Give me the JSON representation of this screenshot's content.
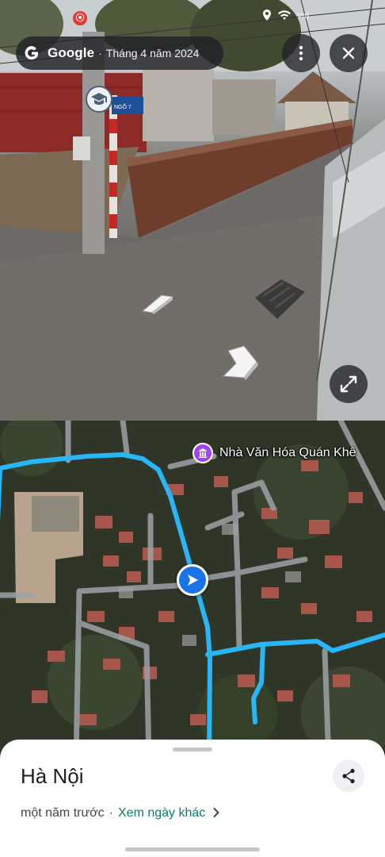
{
  "status_bar": {
    "icons": [
      "gallery-icon",
      "recording-icon",
      "location-icon",
      "wifi-icon",
      "signal-icon"
    ],
    "network_label": "Vo)"
  },
  "street_view": {
    "chip": {
      "brand": "Google",
      "separator": "·",
      "date": "Tháng 4 năm 2024"
    },
    "buttons": [
      "more-icon",
      "close-icon",
      "expand-icon"
    ],
    "sign_text": "NGÕ 7"
  },
  "map": {
    "poi_label": "Nhà Văn Hóa Quán Khê",
    "route_color": "#29b6f6",
    "marker_color": "#1a73e8"
  },
  "sheet": {
    "title": "Hà Nội",
    "time_ago": "một năm trước",
    "dot": "·",
    "other_dates_link": "Xem ngày khác"
  }
}
